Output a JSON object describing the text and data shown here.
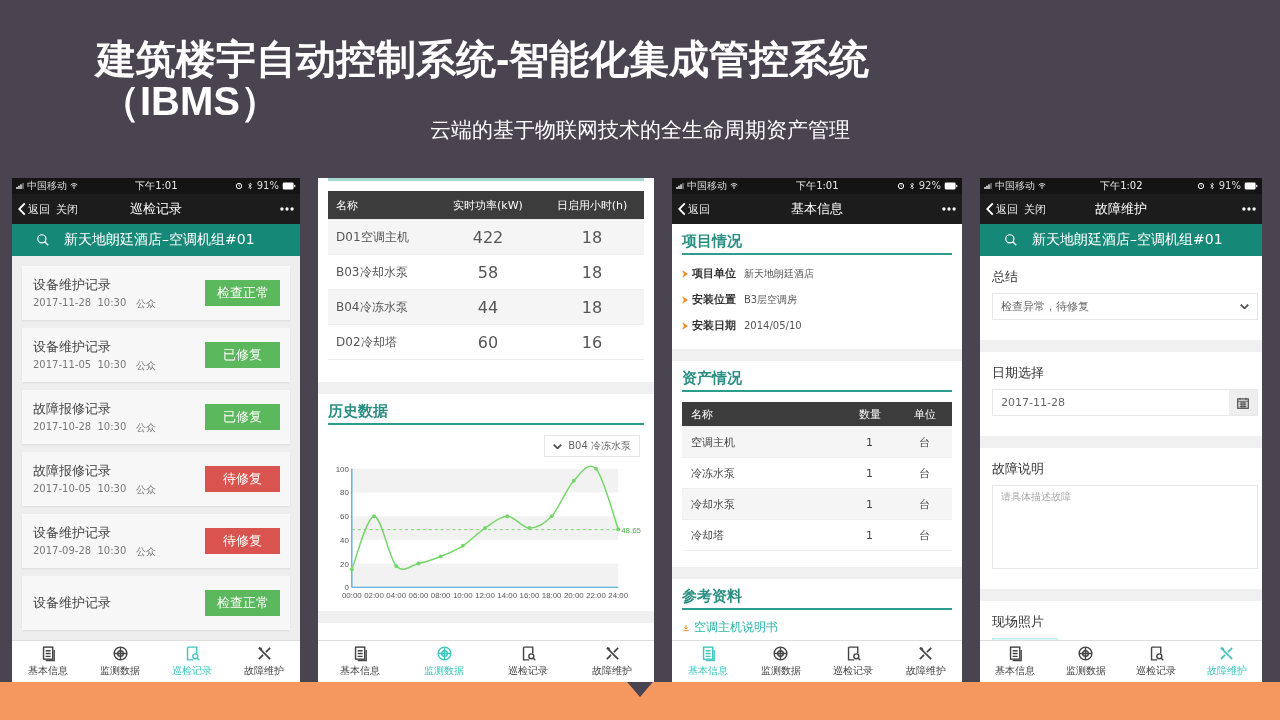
{
  "slide": {
    "title_lines": [
      "建筑楼宇自动控制系统-智能化集成管控系统",
      "（IBMS）"
    ],
    "subtitle": "云端的基于物联网技术的全生命周期资产管理"
  },
  "phones": [
    {
      "kind": "records",
      "status_bar": {
        "carrier": "中国移动",
        "time": "下午1:01",
        "battery": "91%"
      },
      "nav": {
        "back": "返回",
        "close": "关闭",
        "title": "巡检记录"
      },
      "search": "新天地朗廷酒店–空调机组#01",
      "records": [
        {
          "title": "设备维护记录",
          "date": "2017-11-28  10:30",
          "person": "公众",
          "status": "检查正常",
          "kind": "ok"
        },
        {
          "title": "设备维护记录",
          "date": "2017-11-05  10:30",
          "person": "公众",
          "status": "已修复",
          "kind": "ok"
        },
        {
          "title": "故障报修记录",
          "date": "2017-10-28  10:30",
          "person": "公众",
          "status": "已修复",
          "kind": "ok"
        },
        {
          "title": "故障报修记录",
          "date": "2017-10-05  10:30",
          "person": "公众",
          "status": "待修复",
          "kind": "pending"
        },
        {
          "title": "设备维护记录",
          "date": "2017-09-28  10:30",
          "person": "公众",
          "status": "待修复",
          "kind": "pending"
        },
        {
          "title": "设备维护记录",
          "status": "检查正常",
          "kind": "ok"
        }
      ],
      "tabs": [
        {
          "label": "基本信息",
          "selected": false
        },
        {
          "label": "监测数据",
          "selected": false
        },
        {
          "label": "巡检记录",
          "selected": true
        },
        {
          "label": "故障维护",
          "selected": false
        }
      ]
    },
    {
      "kind": "monitor",
      "table": {
        "columns": [
          "名称",
          "实时功率(kW)",
          "日启用小时(h)"
        ],
        "rows": [
          [
            "D01空调主机",
            "422",
            "18"
          ],
          [
            "B03冷却水泵",
            "58",
            "18"
          ],
          [
            "B04冷冻水泵",
            "44",
            "18"
          ],
          [
            "D02冷却塔",
            "60",
            "16"
          ]
        ]
      },
      "section": "历史数据",
      "chart_data": {
        "type": "line",
        "x": [
          "00:00",
          "02:00",
          "04:00",
          "06:00",
          "08:00",
          "10:00",
          "12:00",
          "14:00",
          "16:00",
          "18:00",
          "20:00",
          "22:00",
          "24:00"
        ],
        "series": [
          {
            "name": "B04 冷冻水泵",
            "color": "#77d66b",
            "values": [
              15,
              60,
              18,
              20,
              26,
              35,
              50,
              60,
              50,
              60,
              90,
              100,
              49
            ]
          }
        ],
        "ylim": [
          0,
          100
        ],
        "yticks": [
          0,
          20,
          40,
          60,
          80,
          100
        ],
        "ref_lines": [
          {
            "axis": "y",
            "value": 48.65,
            "label": "48.65"
          }
        ]
      },
      "tabs": [
        {
          "label": "基本信息",
          "selected": false
        },
        {
          "label": "监测数据",
          "selected": true
        },
        {
          "label": "巡检记录",
          "selected": false
        },
        {
          "label": "故障维护",
          "selected": false
        }
      ]
    },
    {
      "kind": "info",
      "status_bar": {
        "carrier": "中国移动",
        "time": "下午1:01",
        "battery": "92%"
      },
      "nav": {
        "back": "返回",
        "title": "基本信息"
      },
      "project": {
        "heading": "项目情况",
        "fields": [
          {
            "label": "项目单位",
            "value": "新天地朗廷酒店"
          },
          {
            "label": "安装位置",
            "value": "B3层空调房"
          },
          {
            "label": "安装日期",
            "value": "2014/05/10"
          }
        ]
      },
      "assets": {
        "heading": "资产情况",
        "columns": [
          "名称",
          "数量",
          "单位"
        ],
        "rows": [
          [
            "空调主机",
            "1",
            "台"
          ],
          [
            "冷冻水泵",
            "1",
            "台"
          ],
          [
            "冷却水泵",
            "1",
            "台"
          ],
          [
            "冷却塔",
            "1",
            "台"
          ]
        ]
      },
      "references": {
        "heading": "参考资料",
        "links": [
          "空调主机说明书"
        ]
      },
      "tabs": [
        {
          "label": "基本信息",
          "selected": true
        },
        {
          "label": "监测数据",
          "selected": false
        },
        {
          "label": "巡检记录",
          "selected": false
        },
        {
          "label": "故障维护",
          "selected": false
        }
      ]
    },
    {
      "kind": "repair",
      "status_bar": {
        "carrier": "中国移动",
        "time": "下午1:02",
        "battery": "91%"
      },
      "nav": {
        "back": "返回",
        "close": "关闭",
        "title": "故障维护"
      },
      "search": "新天地朗廷酒店–空调机组#01",
      "form": [
        {
          "kind": "select",
          "label": "总结",
          "value": "检查异常，待修复"
        },
        {
          "kind": "date",
          "label": "日期选择",
          "value": "2017-11-28"
        },
        {
          "kind": "textarea",
          "label": "故障说明",
          "placeholder": "请具体描述故障"
        },
        {
          "kind": "photo",
          "label": "现场照片"
        }
      ],
      "tabs": [
        {
          "label": "基本信息",
          "selected": false
        },
        {
          "label": "监测数据",
          "selected": false
        },
        {
          "label": "巡检记录",
          "selected": false
        },
        {
          "label": "故障维护",
          "selected": true
        }
      ]
    }
  ]
}
